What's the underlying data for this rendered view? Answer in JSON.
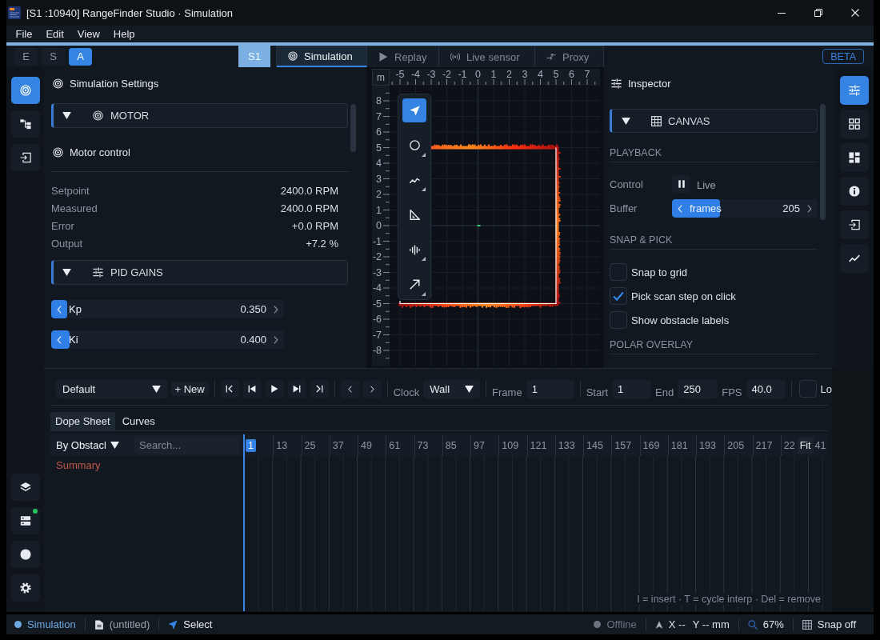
{
  "window": {
    "title": "[S1 :10940] RangeFinder Studio · Simulation"
  },
  "menu": [
    "File",
    "Edit",
    "View",
    "Help"
  ],
  "modes": [
    {
      "label": "E",
      "selected": false
    },
    {
      "label": "S",
      "selected": false
    },
    {
      "label": "A",
      "selected": true
    }
  ],
  "session": "S1",
  "tabs": [
    {
      "label": "Simulation",
      "selected": true
    },
    {
      "label": "Replay",
      "selected": false
    },
    {
      "label": "Live sensor",
      "selected": false
    },
    {
      "label": "Proxy",
      "selected": false
    }
  ],
  "badge": "BETA",
  "left_rail": {
    "top": [
      {
        "selected": true
      },
      {
        "selected": false
      },
      {
        "selected": false
      }
    ],
    "bottom": [
      {
        "selected": false,
        "status_dot": false
      },
      {
        "selected": false,
        "status_dot": true
      },
      {
        "selected": false,
        "status_dot": false
      },
      {
        "selected": false,
        "status_dot": false
      }
    ]
  },
  "settings": {
    "title": "Simulation Settings",
    "sections": [
      {
        "title": "MOTOR",
        "expanded": true,
        "subtitle": "Motor control",
        "readouts": [
          {
            "label": "Setpoint",
            "value": "2400.0 RPM"
          },
          {
            "label": "Measured",
            "value": "2400.0 RPM"
          },
          {
            "label": "Error",
            "value": "+0.0 RPM"
          },
          {
            "label": "Output",
            "value": "+7.2 %"
          }
        ]
      },
      {
        "title": "PID GAINS",
        "expanded": true,
        "sliders": [
          {
            "label": "Kp",
            "value": "0.350",
            "level": 0.07
          },
          {
            "label": "Ki",
            "value": "0.400",
            "level": 0.08
          }
        ]
      }
    ]
  },
  "canvas": {
    "unit": "m",
    "x_ticks": [
      "-5",
      "-4",
      "-3",
      "-2",
      "-1",
      "0",
      "1",
      "2",
      "3",
      "4",
      "5",
      "6",
      "7"
    ],
    "y_ticks": [
      "8",
      "7",
      "6",
      "5",
      "4",
      "3",
      "2",
      "1",
      "0",
      "-1",
      "-2",
      "-3",
      "-4",
      "-5",
      "-6",
      "-7",
      "-8"
    ],
    "tools": [
      {
        "selected": true,
        "submenu": false
      },
      {
        "selected": false,
        "submenu": true
      },
      {
        "selected": false,
        "submenu": true
      },
      {
        "selected": false,
        "submenu": false
      },
      {
        "selected": false,
        "submenu": true
      },
      {
        "selected": false,
        "submenu": true
      }
    ]
  },
  "inspector": {
    "title": "Inspector",
    "section": {
      "title": "CANVAS",
      "expanded": true
    },
    "playback": {
      "title": "PLAYBACK",
      "control": {
        "label": "Control",
        "value": "Live"
      },
      "buffer": {
        "label": "Buffer",
        "name": "frames",
        "value": "205",
        "level": 0.33
      }
    },
    "snap": {
      "title": "SNAP & PICK",
      "options": [
        {
          "label": "Snap to grid",
          "checked": false
        },
        {
          "label": "Pick scan step on click",
          "checked": true
        },
        {
          "label": "Show obstacle labels",
          "checked": false
        }
      ]
    },
    "polar": {
      "title": "POLAR OVERLAY"
    }
  },
  "right_rail": [
    {
      "selected": true
    },
    {
      "selected": false
    },
    {
      "selected": false
    },
    {
      "selected": false
    },
    {
      "selected": false
    },
    {
      "selected": false
    }
  ],
  "timeline": {
    "toolbar": {
      "preset": "Default",
      "new_button": "+ New",
      "clock": {
        "label": "Clock",
        "value": "Wall"
      },
      "fields": [
        {
          "label": "Frame",
          "value": "1"
        },
        {
          "label": "Start",
          "value": "1"
        },
        {
          "label": "End",
          "value": "250"
        },
        {
          "label": "FPS",
          "value": "40.0"
        }
      ],
      "loop": {
        "label": "Lo",
        "checked": false
      }
    },
    "tabs": [
      {
        "label": "Dope Sheet",
        "selected": true
      },
      {
        "label": "Curves",
        "selected": false
      }
    ],
    "group_by": "By Obstacl",
    "search": {
      "placeholder": "Search..."
    },
    "ruler": {
      "frames": [
        {
          "label": "1",
          "selected": true
        },
        {
          "label": "13",
          "selected": false
        },
        {
          "label": "25",
          "selected": false
        },
        {
          "label": "37",
          "selected": false
        },
        {
          "label": "49",
          "selected": false
        },
        {
          "label": "61",
          "selected": false
        },
        {
          "label": "73",
          "selected": false
        },
        {
          "label": "85",
          "selected": false
        },
        {
          "label": "97",
          "selected": false
        },
        {
          "label": "109",
          "selected": false
        },
        {
          "label": "121",
          "selected": false
        },
        {
          "label": "133",
          "selected": false
        },
        {
          "label": "145",
          "selected": false
        },
        {
          "label": "157",
          "selected": false
        },
        {
          "label": "169",
          "selected": false
        },
        {
          "label": "181",
          "selected": false
        },
        {
          "label": "193",
          "selected": false
        },
        {
          "label": "205",
          "selected": false
        },
        {
          "label": "217",
          "selected": false
        },
        {
          "label": "22",
          "selected": false
        }
      ],
      "fit_button": "Fit",
      "frames_after_fit": [
        "41"
      ]
    },
    "rows": [
      {
        "label": "Summary"
      }
    ],
    "hint": "I = insert · T = cycle interp · Del = remove"
  },
  "status_bar": {
    "left": [
      {
        "kind": "status",
        "text": "Simulation",
        "color": "#6ea8e2"
      },
      {
        "kind": "file",
        "text": "(untitled)"
      },
      {
        "kind": "tool",
        "text": "Select"
      }
    ],
    "right": [
      {
        "kind": "status",
        "text": "Offline",
        "color": "#6b7480"
      },
      {
        "kind": "cursor",
        "x": "X --",
        "y": "Y -- mm"
      },
      {
        "kind": "zoom",
        "text": "67%"
      },
      {
        "kind": "snap",
        "text": "Snap off"
      }
    ]
  }
}
